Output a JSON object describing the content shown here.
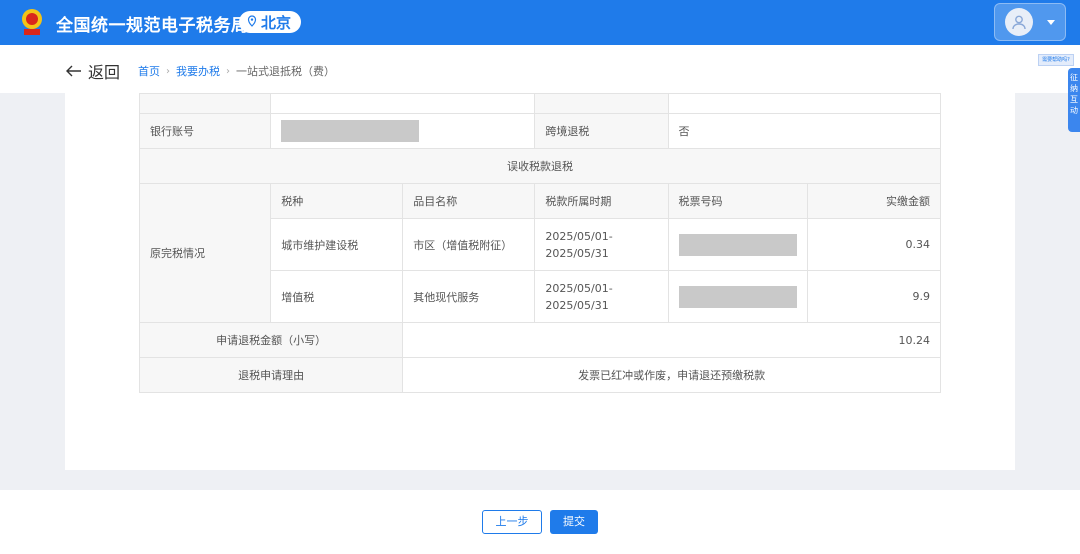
{
  "header": {
    "app_title": "全国统一规范电子税务局",
    "region": "北京",
    "brand_color": "#1f7bea"
  },
  "nav": {
    "back_label": "返回",
    "breadcrumb": [
      "首页",
      "我要办税",
      "一站式退抵税（费）"
    ]
  },
  "help_tag": "需要帮助吗?",
  "side_float": [
    "征",
    "纳",
    "互",
    "动"
  ],
  "table": {
    "bank_account_label": "银行账号",
    "cross_region_label": "跨境退税",
    "cross_region_value": "否",
    "section_title": "误收税款退税",
    "original_tax_label": "原完税情况",
    "columns": [
      "税种",
      "品目名称",
      "税款所属时期",
      "税票号码",
      "实缴金额"
    ],
    "rows": [
      {
        "tax_type": "城市维护建设税",
        "item": "市区（增值税附征）",
        "period_start": "2025/05/01-",
        "period_end": "2025/05/31",
        "amount": "0.34"
      },
      {
        "tax_type": "增值税",
        "item": "其他现代服务",
        "period_start": "2025/05/01-",
        "period_end": "2025/05/31",
        "amount": "9.9"
      }
    ],
    "refund_amount_label": "申请退税金额（小写）",
    "refund_amount_value": "10.24",
    "refund_reason_label": "退税申请理由",
    "refund_reason_value": "发票已红冲或作废，申请退还预缴税款"
  },
  "footer": {
    "prev_label": "上一步",
    "submit_label": "提交"
  }
}
